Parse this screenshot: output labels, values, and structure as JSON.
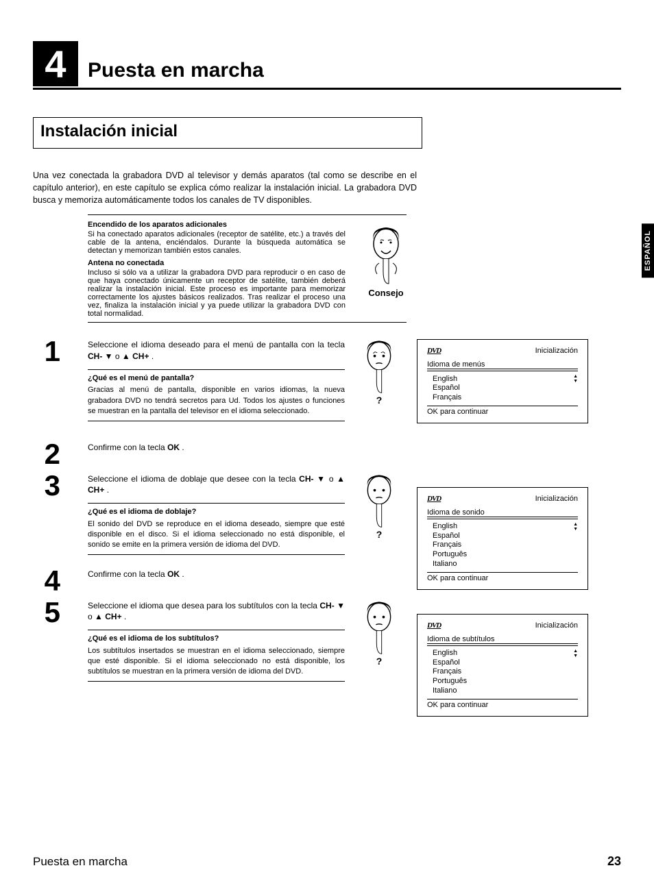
{
  "sidetab": "ESPAÑOL",
  "chapter": {
    "num": "4",
    "title": "Puesta en marcha"
  },
  "section": "Instalación inicial",
  "intro": "Una vez conectada la grabadora DVD al televisor y demás aparatos (tal como se describe en el capítulo anterior), en este capítulo se explica cómo realizar la instalación inicial. La grabadora DVD busca y memoriza automáticamente todos los canales de TV disponibles.",
  "tip": {
    "h1": "Encendido de los aparatos adicionales",
    "p1": "Si ha conectado aparatos adicionales (receptor de satélite, etc.) a través del cable de la antena, enciéndalos. Durante la búsqueda automática se detectan y memorizan también estos canales.",
    "h2": "Antena no conectada",
    "p2": "Incluso si sólo va a utilizar la grabadora DVD para reproducir o en caso de que haya conectado únicamente un receptor de satélite, también deberá realizar la instalación inicial. Este proceso es importante para memorizar correctamente los ajustes básicos realizados. Tras realizar el proceso una vez, finaliza la instalación inicial y ya puede utilizar la grabadora DVD con total normalidad.",
    "label": "Consejo"
  },
  "steps": {
    "s1": {
      "n": "1",
      "text_a": "Seleccione el idioma deseado para el menú de pantalla con la tecla ",
      "key1": "CH-",
      "or": " o ",
      "key2": "CH+",
      "dot": " .",
      "q": "¿Qué es el menú de pantalla?",
      "qa": "Gracias al menú de pantalla, disponible en varios idiomas, la nueva grabadora DVD no tendrá secretos para Ud. Todos los ajustes o funciones se muestran en la pantalla del televisor en el idioma seleccionado."
    },
    "s2": {
      "n": "2",
      "text": "Confirme con la tecla ",
      "key": "OK",
      "dot": " ."
    },
    "s3": {
      "n": "3",
      "text_a": "Seleccione el idioma de doblaje que desee con la tecla ",
      "key1": "CH-",
      "or": " o ",
      "key2": "CH+",
      "dot": " .",
      "q": "¿Qué es el idioma de doblaje?",
      "qa": "El sonido del DVD se reproduce en el idioma deseado, siempre que esté disponible en el disco. Si el idioma seleccionado no está disponible, el sonido se emite en la primera versión de idioma del DVD."
    },
    "s4": {
      "n": "4",
      "text": "Confirme con la tecla ",
      "key": "OK",
      "dot": " ."
    },
    "s5": {
      "n": "5",
      "text_a": "Seleccione el idioma que desea para los subtítulos con la tecla ",
      "key1": "CH-",
      "or": " o ",
      "key2": "CH+",
      "dot": " .",
      "q": "¿Qué es el idioma de los subtítulos?",
      "qa": "Los subtítulos insertados se muestran en el idioma seleccionado, siempre que esté disponible. Si el idioma seleccionado no está disponible, los subtítulos se muestran en la primera versión de idioma del DVD."
    }
  },
  "screens": {
    "dvd": "DVD",
    "init": "Inicialización",
    "s1": {
      "label": "Idioma de menús",
      "items": [
        "English",
        "Español",
        "Français"
      ],
      "foot": "OK para continuar"
    },
    "s2": {
      "label": "Idioma de sonido",
      "items": [
        "English",
        "Español",
        "Français",
        "Português",
        "Italiano"
      ],
      "foot": "OK para continuar"
    },
    "s3": {
      "label": "Idioma de subtítulos",
      "items": [
        "English",
        "Español",
        "Français",
        "Português",
        "Italiano"
      ],
      "foot": "OK para continuar"
    }
  },
  "footer": {
    "title": "Puesta en marcha",
    "page": "23"
  },
  "qmark": "?"
}
